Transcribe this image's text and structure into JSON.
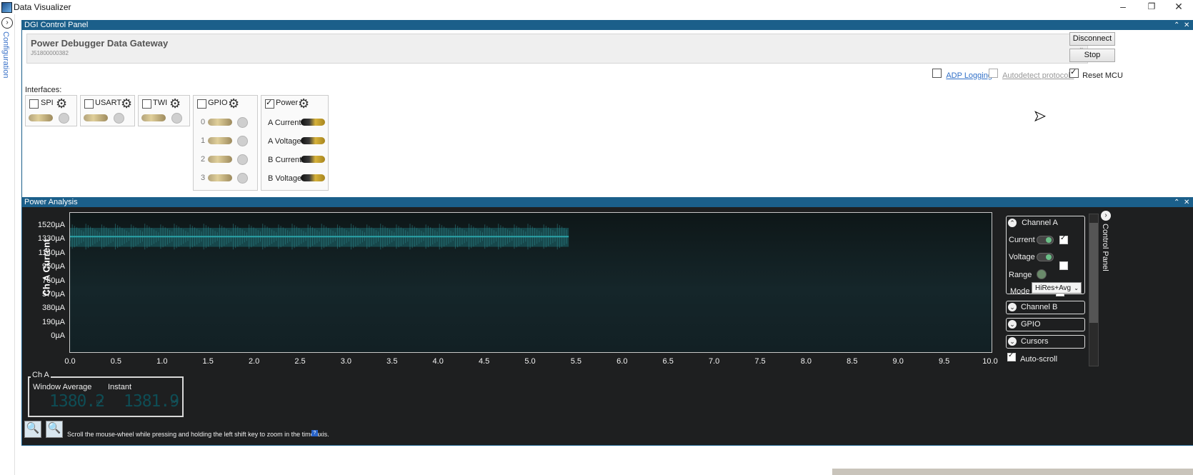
{
  "window": {
    "title": "Data Visualizer"
  },
  "sidebar": {
    "config_label": "Configuration"
  },
  "dgi": {
    "panel_title": "DGI Control Panel",
    "gateway_name": "Power Debugger Data Gateway",
    "gateway_serial": "J51800000382",
    "disconnect_label": "Disconnect",
    "stop_label": "Stop",
    "adp_logging_label": "ADP Logging",
    "autodetect_label": "Autodetect protocols",
    "reset_mcu_label": "Reset MCU",
    "interfaces_label": "Interfaces:",
    "interfaces": [
      {
        "label": "SPI",
        "checked": false
      },
      {
        "label": "USART",
        "checked": false
      },
      {
        "label": "TWI",
        "checked": false
      },
      {
        "label": "GPIO",
        "checked": false
      },
      {
        "label": "Power",
        "checked": true
      }
    ],
    "gpio_pins": [
      "0",
      "1",
      "2",
      "3"
    ],
    "power_channels": [
      "A Current",
      "A Voltage",
      "B Current",
      "B Voltage"
    ]
  },
  "power": {
    "panel_title": "Power Analysis",
    "cha_title": "Ch A",
    "window_avg_label": "Window Average",
    "instant_label": "Instant",
    "window_avg_value": "1380.2",
    "instant_value": "1381.9",
    "unit_label": "µA",
    "hint_text": "Scroll the mouse-wheel while pressing and holding the left shift key to zoom in the time axis."
  },
  "control_panel": {
    "title": "Control Panel",
    "channel_a": "Channel A",
    "current_label": "Current",
    "voltage_label": "Voltage",
    "range_label": "Range",
    "mode_label": "Mode",
    "mode_value": "HiRes+Avg",
    "channel_b": "Channel B",
    "gpio": "GPIO",
    "cursors": "Cursors",
    "autoscroll_label": "Auto-scroll",
    "current_checked": true,
    "voltage_checked": false,
    "range_checked": false,
    "autoscroll_checked": true
  },
  "chart_data": {
    "type": "line",
    "ylabel": "Ch A Current",
    "xlabel": "",
    "y_ticks": [
      "0µA",
      "190µA",
      "380µA",
      "570µA",
      "760µA",
      "950µA",
      "1140µA",
      "1330µA",
      "1520µA"
    ],
    "x_ticks": [
      "0.0",
      "0.5",
      "1.0",
      "1.5",
      "2.0",
      "2.5",
      "3.0",
      "3.5",
      "4.0",
      "4.5",
      "5.0",
      "5.5",
      "6.0",
      "6.5",
      "7.0",
      "7.5",
      "8.0",
      "8.5",
      "9.0",
      "9.5",
      "10.0"
    ],
    "xlim": [
      0,
      10
    ],
    "ylim": [
      0,
      1520
    ],
    "series": [
      {
        "x": [
          0,
          5.42
        ],
        "y": [
          1380,
          1380
        ],
        "noise_band": [
          1240,
          1500
        ]
      }
    ],
    "colors": {
      "trace": "#2aa3a8",
      "band": "#1d6a70"
    }
  }
}
